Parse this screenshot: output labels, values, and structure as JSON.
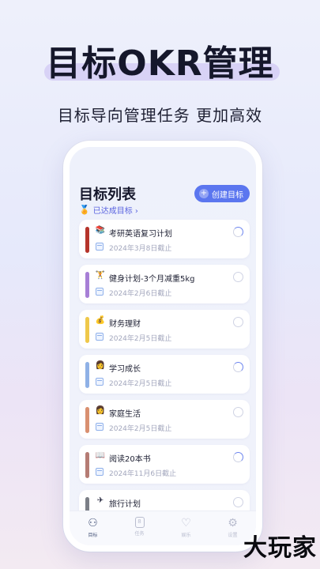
{
  "promo": {
    "headline": "目标OKR管理",
    "subtitle": "目标导向管理任务 更加高效"
  },
  "app": {
    "list_title": "目标列表",
    "achieved_link": "已达成目标 ›",
    "create_button": "创建目标",
    "goals": [
      {
        "emoji": "📚",
        "name": "考研英语复习计划",
        "deadline": "2024年3月8日截止",
        "color": "#b5342b",
        "check": "partial"
      },
      {
        "emoji": "🏋",
        "name": "健身计划-3个月减重5kg",
        "deadline": "2024年2月6日截止",
        "color": "#a77fd6",
        "check": "empty"
      },
      {
        "emoji": "💰",
        "name": "财务理财",
        "deadline": "2024年2月5日截止",
        "color": "#efc84a",
        "check": "empty"
      },
      {
        "emoji": "👩",
        "name": "学习成长",
        "deadline": "2024年2月5日截止",
        "color": "#8fb1e6",
        "check": "partial"
      },
      {
        "emoji": "👩",
        "name": "家庭生活",
        "deadline": "2024年2月5日截止",
        "color": "#d99070",
        "check": "empty"
      },
      {
        "emoji": "📖",
        "name": "阅读20本书",
        "deadline": "2024年11月6日截止",
        "color": "#b57c74",
        "check": "partial"
      },
      {
        "emoji": "✈",
        "name": "旅行计划",
        "deadline": "",
        "color": "#7c7f87",
        "check": "empty"
      }
    ],
    "tabs": [
      {
        "label": "目标",
        "icon": "target-icon",
        "glyph": "⚇",
        "active": true
      },
      {
        "label": "任务",
        "icon": "task-icon",
        "glyph": "8",
        "active": false
      },
      {
        "label": "娱乐",
        "icon": "heart-icon",
        "glyph": "♡",
        "active": false
      },
      {
        "label": "设置",
        "icon": "gear-icon",
        "glyph": "⚙",
        "active": false
      }
    ]
  },
  "watermark": "大玩家"
}
